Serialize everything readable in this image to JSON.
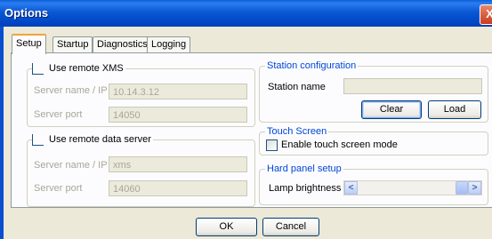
{
  "window": {
    "title": "Options",
    "close_label": "X"
  },
  "tabs": [
    {
      "label": "Setup",
      "active": true
    },
    {
      "label": "Startup",
      "active": false
    },
    {
      "label": "Diagnostics",
      "active": false
    },
    {
      "label": "Logging",
      "active": false
    }
  ],
  "remote_xms": {
    "checkbox_label": "Use remote XMS",
    "checked": false,
    "server_label": "Server name / IP",
    "server_value": "10.14.3.12",
    "port_label": "Server port",
    "port_value": "14050"
  },
  "remote_data": {
    "checkbox_label": "Use remote data server",
    "checked": false,
    "server_label": "Server name / IP",
    "server_value": "xms",
    "port_label": "Server port",
    "port_value": "14060"
  },
  "station": {
    "title": "Station configuration",
    "name_label": "Station name",
    "name_value": "",
    "clear_label": "Clear",
    "load_label": "Load"
  },
  "touch": {
    "title": "Touch Screen",
    "checkbox_label": "Enable touch screen mode",
    "checked": false
  },
  "hard_panel": {
    "title": "Hard panel setup",
    "lamp_label": "Lamp brightness",
    "lamp_level": 1.0,
    "left_arrow": "<",
    "right_arrow": ">"
  },
  "footer": {
    "ok_label": "OK",
    "cancel_label": "Cancel"
  }
}
